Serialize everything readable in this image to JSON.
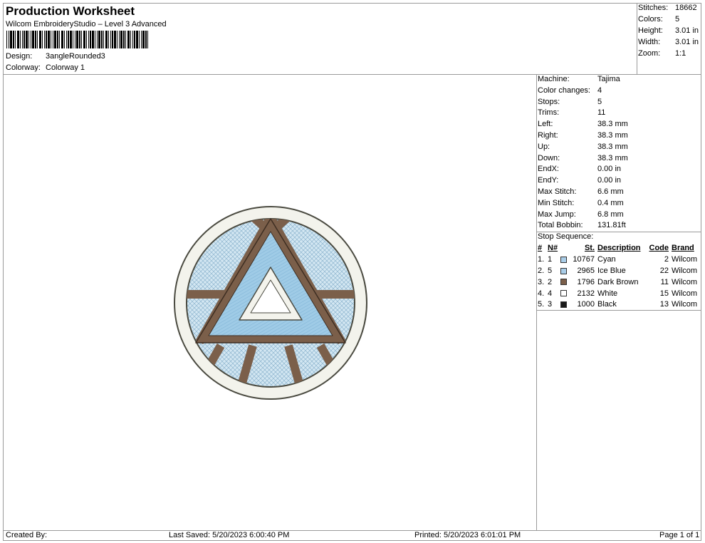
{
  "header": {
    "title": "Production Worksheet",
    "software": "Wilcom EmbroideryStudio – Level 3 Advanced",
    "design_label": "Design:",
    "design_value": "3angleRounded3",
    "colorway_label": "Colorway:",
    "colorway_value": "Colorway 1"
  },
  "summary": [
    {
      "label": "Stitches:",
      "value": "18662"
    },
    {
      "label": "Colors:",
      "value": "5"
    },
    {
      "label": "Height:",
      "value": "3.01 in"
    },
    {
      "label": "Width:",
      "value": "3.01 in"
    },
    {
      "label": "Zoom:",
      "value": "1:1"
    }
  ],
  "machine_info": [
    {
      "label": "Machine:",
      "value": "Tajima"
    },
    {
      "label": "Color changes:",
      "value": "4"
    },
    {
      "label": "Stops:",
      "value": "5"
    },
    {
      "label": "Trims:",
      "value": "11"
    },
    {
      "label": "Left:",
      "value": "38.3 mm"
    },
    {
      "label": "Right:",
      "value": "38.3 mm"
    },
    {
      "label": "Up:",
      "value": "38.3 mm"
    },
    {
      "label": "Down:",
      "value": "38.3 mm"
    },
    {
      "label": "EndX:",
      "value": "0.00 in"
    },
    {
      "label": "EndY:",
      "value": "0.00 in"
    },
    {
      "label": "Max Stitch:",
      "value": "6.6 mm"
    },
    {
      "label": "Min Stitch:",
      "value": "0.4 mm"
    },
    {
      "label": "Max Jump:",
      "value": "6.8 mm"
    },
    {
      "label": "Total Bobbin:",
      "value": "131.81ft"
    }
  ],
  "stop_sequence": {
    "heading": "Stop Sequence:",
    "columns": [
      "#",
      "N#",
      "St.",
      "Description",
      "Code",
      "Brand"
    ],
    "rows": [
      {
        "num": "1.",
        "n": "1",
        "color": "#a9cde8",
        "st": "10767",
        "desc": "Cyan",
        "code": "2",
        "brand": "Wilcom"
      },
      {
        "num": "2.",
        "n": "5",
        "color": "#a9cde8",
        "st": "2965",
        "desc": "Ice Blue",
        "code": "22",
        "brand": "Wilcom"
      },
      {
        "num": "3.",
        "n": "2",
        "color": "#7b5f4a",
        "st": "1796",
        "desc": "Dark Brown",
        "code": "11",
        "brand": "Wilcom"
      },
      {
        "num": "4.",
        "n": "4",
        "color": "#ffffff",
        "st": "2132",
        "desc": "White",
        "code": "15",
        "brand": "Wilcom"
      },
      {
        "num": "5.",
        "n": "3",
        "color": "#1a1a1a",
        "st": "1000",
        "desc": "Black",
        "code": "13",
        "brand": "Wilcom"
      }
    ]
  },
  "footer": {
    "created_by": "Created By:",
    "last_saved": "Last Saved: 5/20/2023 6:00:40 PM",
    "printed": "Printed: 5/20/2023 6:01:01 PM",
    "page": "Page 1 of 1"
  }
}
